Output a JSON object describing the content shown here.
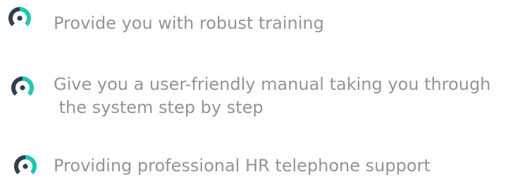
{
  "items": [
    {
      "icon": "ring-icon",
      "text": "Provide you with robust training"
    },
    {
      "icon": "ring-icon",
      "line1": "Give you a user-friendly manual taking you through",
      "line2": " the system step by step"
    },
    {
      "icon": "ring-icon",
      "text": "Providing professional HR telephone support"
    }
  ],
  "colors": {
    "icon_dark": "#2f3f4d",
    "icon_accent": "#1fc6b0",
    "text": "#949494"
  }
}
